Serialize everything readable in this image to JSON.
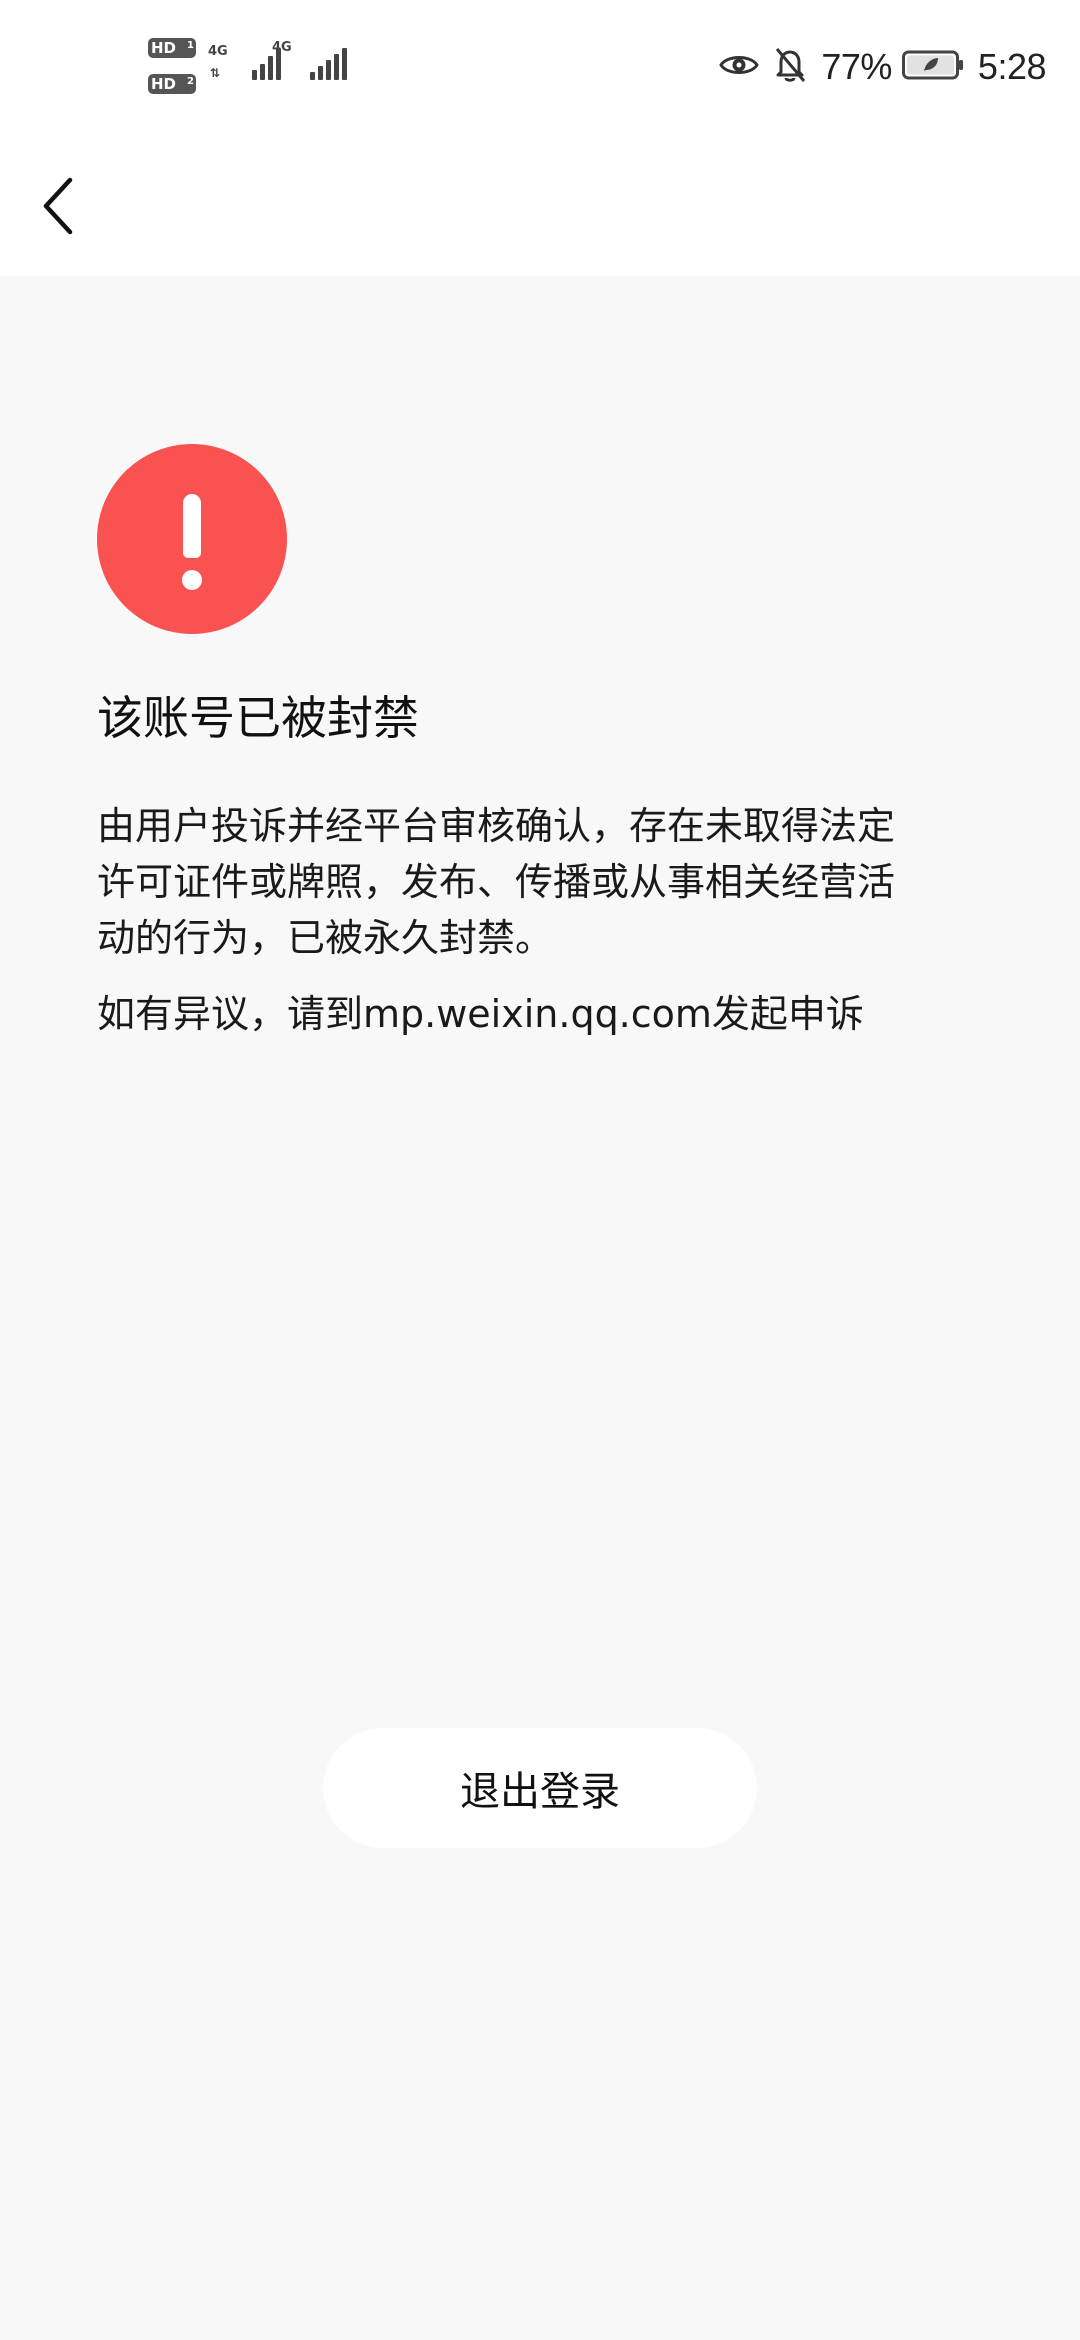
{
  "status_bar": {
    "sim1_badge": "HD",
    "sim1_index": "1",
    "sim2_badge": "HD",
    "sim2_index": "2",
    "network1": "4G",
    "network2": "4G",
    "battery_percent": "77%",
    "time": "5:28",
    "icons": [
      "eye-icon",
      "bell-muted-icon",
      "battery-saver-icon"
    ]
  },
  "nav": {
    "back_icon": "chevron-left-icon"
  },
  "alert": {
    "icon": "warning-exclamation-icon",
    "icon_color": "#fa5151",
    "title": "该账号已被封禁",
    "description_lines": [
      "由用户投诉并经平台审核确认，存在未取得法定",
      "许可证件或牌照，发布、传播或从事相关经营活",
      "动的行为，已被永久封禁。"
    ],
    "appeal_text": "如有异议，请到mp.weixin.qq.com发起申诉"
  },
  "actions": {
    "logout_label": "退出登录"
  }
}
